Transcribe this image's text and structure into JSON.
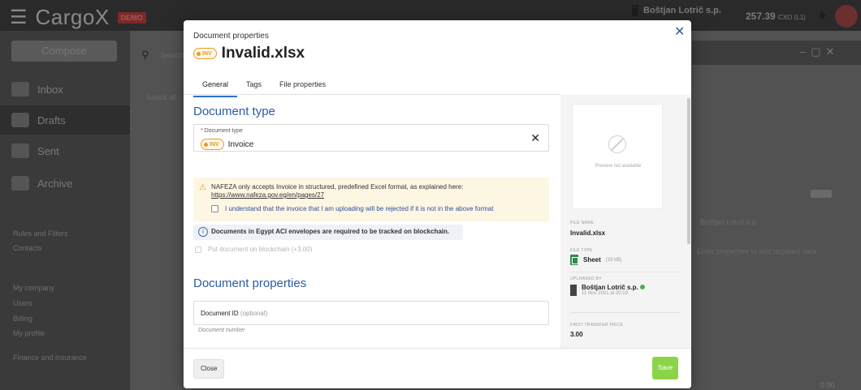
{
  "app": {
    "logo": "CargoX",
    "logo_badge": "DEMO",
    "company": "Boštjan Lotrič s.p.",
    "balance": "257.39",
    "balance_unit": "CXO (L1)",
    "compose": "Compose",
    "nav": [
      "Inbox",
      "Drafts",
      "Sent",
      "Archive"
    ],
    "links": [
      "Rules and Filters",
      "Contacts",
      "My company",
      "Users",
      "Billing",
      "My profile",
      "Finance and insurance"
    ],
    "search_placeholder": "Search",
    "select_all": "Select all",
    "right_company": "Boštjan Lotrič s.p.",
    "right_hint": "Enter properties to add required data",
    "bottom_value": "0.00"
  },
  "modal": {
    "caption": "Document properties",
    "title": "Invalid.xlsx",
    "chip_label": "INV",
    "tabs": [
      "General",
      "Tags",
      "File properties"
    ],
    "doc_type_section": "Document type",
    "doc_type_label": "Document type",
    "doc_type_value": "Invoice",
    "warning_text": "NAFEZA only accepts Invoice in structured, predefined Excel format, as explained here:",
    "warning_link": "https://www.nafeza.gov.eg/en/pages/27",
    "checkbox_text": "I understand that the invoice that I am uploading will be rejected if it is not in the above format",
    "info_text": "Documents in Egypt ACI envelopes are required to be tracked on blockchain.",
    "blockchain_text": "Put document on blockchain (+3.00",
    "blockchain_suffix": ")",
    "doc_props_section": "Document properties",
    "doc_id_label": "Document ID",
    "doc_id_optional": "(optional)",
    "doc_id_help": "Document number",
    "preview_text": "Preview not available",
    "file_name_label": "FILE NAME",
    "file_name": "Invalid.xlsx",
    "file_type_label": "FILE TYPE",
    "file_type": "Sheet",
    "file_size": "(19 kB)",
    "uploaded_by_label": "UPLOADED BY",
    "uploaded_by": "Boštjan Lotrič s.p.",
    "uploaded_at": "11 Nov 2021 at 20:19",
    "transfer_price_label": "FIRST TRANSFER PRICE",
    "transfer_price": "3.00",
    "close_btn": "Close",
    "save_btn": "Save"
  },
  "colors": {
    "accent": "#2d6fd6",
    "inv_chip": "#e79b23",
    "save": "#8bd448",
    "section_title": "#2d5aa8"
  }
}
